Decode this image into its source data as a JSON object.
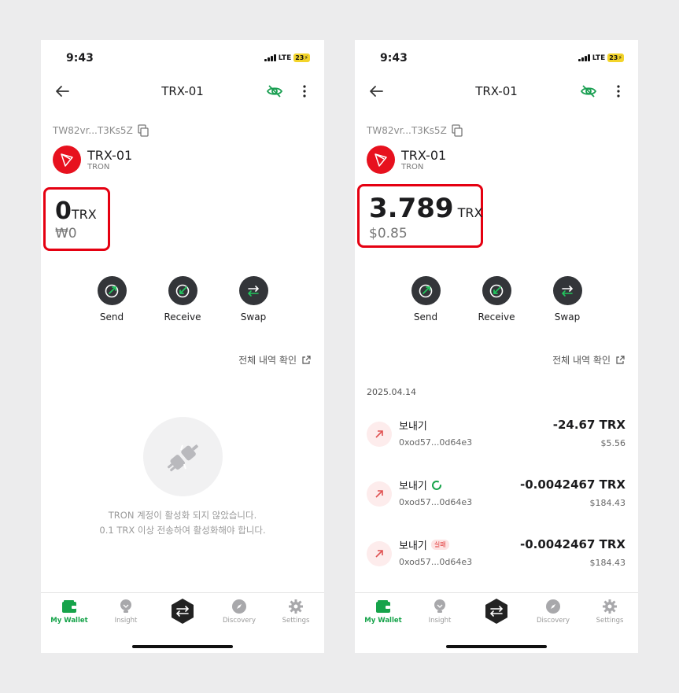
{
  "colors": {
    "accent": "#16a34a",
    "tron_red": "#e7111e",
    "highlight_box": "#e50011",
    "fail": "#e03b3b"
  },
  "phones": [
    {
      "status": {
        "time": "9:43",
        "network": "LTE",
        "battery": "23"
      },
      "header": {
        "title": "TRX-01"
      },
      "address": "TW82vr...T3Ks5Z",
      "token": {
        "name": "TRX-01",
        "network": "TRON"
      },
      "balance": {
        "amount": "0",
        "unit": "TRX",
        "fiat": "₩0"
      },
      "actions": [
        "Send",
        "Receive",
        "Swap"
      ],
      "history_link": "전체 내역 확인",
      "empty_state": {
        "line1": "TRON 계정이 활성화 되지 않았습니다.",
        "line2": "0.1 TRX 이상 전송하여 활성화해야 합니다."
      },
      "tabs": [
        "My Wallet",
        "Insight",
        "Discovery",
        "Settings"
      ]
    },
    {
      "status": {
        "time": "9:43",
        "network": "LTE",
        "battery": "23"
      },
      "header": {
        "title": "TRX-01"
      },
      "address": "TW82vr...T3Ks5Z",
      "token": {
        "name": "TRX-01",
        "network": "TRON"
      },
      "balance": {
        "amount": "3.789",
        "unit": "TRX",
        "fiat": "$0.85"
      },
      "actions": [
        "Send",
        "Receive",
        "Swap"
      ],
      "history_link": "전체 내역 확인",
      "tx_date": "2025.04.14",
      "transactions": [
        {
          "name": "보내기",
          "hash": "0xod57...0d64e3",
          "amount": "-24.67 TRX",
          "fiat": "$5.56"
        },
        {
          "name": "보내기",
          "hash": "0xod57...0d64e3",
          "amount": "-0.0042467 TRX",
          "fiat": "$184.43",
          "status_icon": "pending-spinner-icon"
        },
        {
          "name": "보내기",
          "hash": "0xod57...0d64e3",
          "amount": "-0.0042467 TRX",
          "fiat": "$184.43",
          "badge": "실패"
        }
      ],
      "tabs": [
        "My Wallet",
        "Insight",
        "Discovery",
        "Settings"
      ]
    }
  ]
}
